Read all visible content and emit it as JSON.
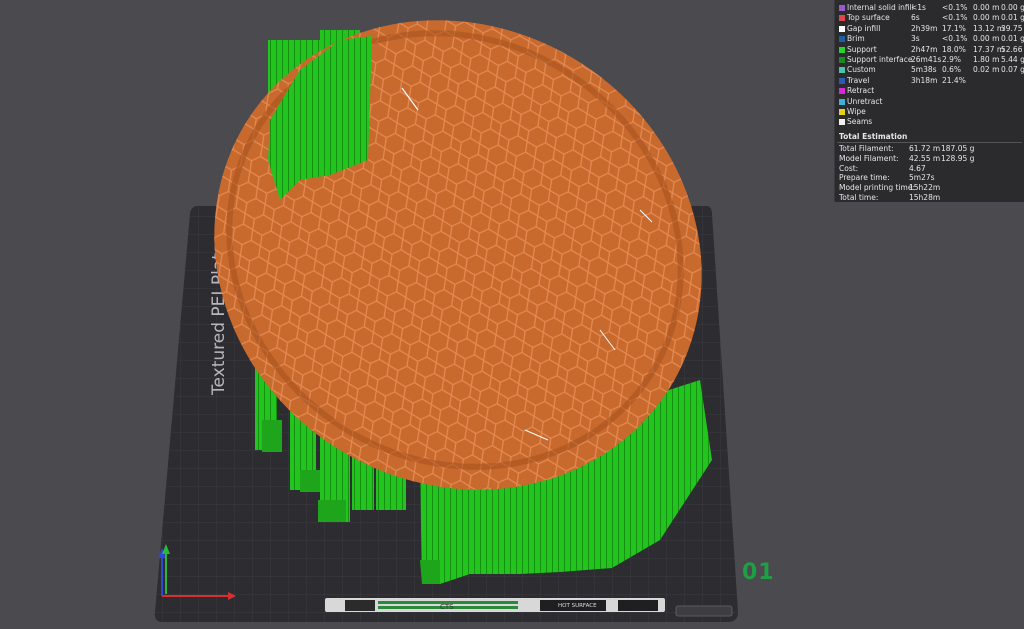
{
  "plate": {
    "name": "Textured PEI Plate",
    "number": "01",
    "strip_center": "CTS",
    "strip_right": "HOT\nSURFACE"
  },
  "legend": {
    "rows": [
      {
        "name": "Internal solid infill",
        "time": "<1s",
        "pct": "<0.1%",
        "len": "0.00 m",
        "wt": "0.00 g",
        "color": "#9b59d0"
      },
      {
        "name": "Top surface",
        "time": "6s",
        "pct": "<0.1%",
        "len": "0.00 m",
        "wt": "0.01 g",
        "color": "#e0464c"
      },
      {
        "name": "Gap infill",
        "time": "2h39m",
        "pct": "17.1%",
        "len": "13.12 m",
        "wt": "39.75 g",
        "color": "#ffffff"
      },
      {
        "name": "Brim",
        "time": "3s",
        "pct": "<0.1%",
        "len": "0.00 m",
        "wt": "0.01 g",
        "color": "#1a5fa8"
      },
      {
        "name": "Support",
        "time": "2h47m",
        "pct": "18.0%",
        "len": "17.37 m",
        "wt": "52.66 g",
        "color": "#25d62a"
      },
      {
        "name": "Support interface",
        "time": "26m41s",
        "pct": "2.9%",
        "len": "1.80 m",
        "wt": "5.44 g",
        "color": "#1a8a22"
      },
      {
        "name": "Custom",
        "time": "5m38s",
        "pct": "0.6%",
        "len": "0.02 m",
        "wt": "0.07 g",
        "color": "#4cc4a6"
      },
      {
        "name": "Travel",
        "time": "3h18m",
        "pct": "21.4%",
        "len": "",
        "wt": "",
        "color": "#2a5ab8"
      },
      {
        "name": "Retract",
        "time": "",
        "pct": "",
        "len": "",
        "wt": "",
        "color": "#d62ad6"
      },
      {
        "name": "Unretract",
        "time": "",
        "pct": "",
        "len": "",
        "wt": "",
        "color": "#3cb4d8"
      },
      {
        "name": "Wipe",
        "time": "",
        "pct": "",
        "len": "",
        "wt": "",
        "color": "#e6d21a"
      },
      {
        "name": "Seams",
        "time": "",
        "pct": "",
        "len": "",
        "wt": "",
        "color": "#f0f0f0"
      }
    ],
    "estimation_title": "Total Estimation",
    "estimation": [
      {
        "label": "Total Filament:",
        "v1": "61.72 m",
        "v2": "187.05 g"
      },
      {
        "label": "Model Filament:",
        "v1": "42.55 m",
        "v2": "128.95 g"
      },
      {
        "label": "Cost:",
        "v1": "4.67",
        "v2": ""
      },
      {
        "label": "Prepare time:",
        "v1": "5m27s",
        "v2": ""
      },
      {
        "label": "Model printing time:",
        "v1": "15h22m",
        "v2": ""
      },
      {
        "label": "Total time:",
        "v1": "15h28m",
        "v2": ""
      }
    ]
  },
  "colors": {
    "background": "#4a4a4f",
    "plate": "#2c2c31",
    "model": "#c8692e",
    "support": "#22c41e",
    "plate_label": "#1f9e44"
  }
}
